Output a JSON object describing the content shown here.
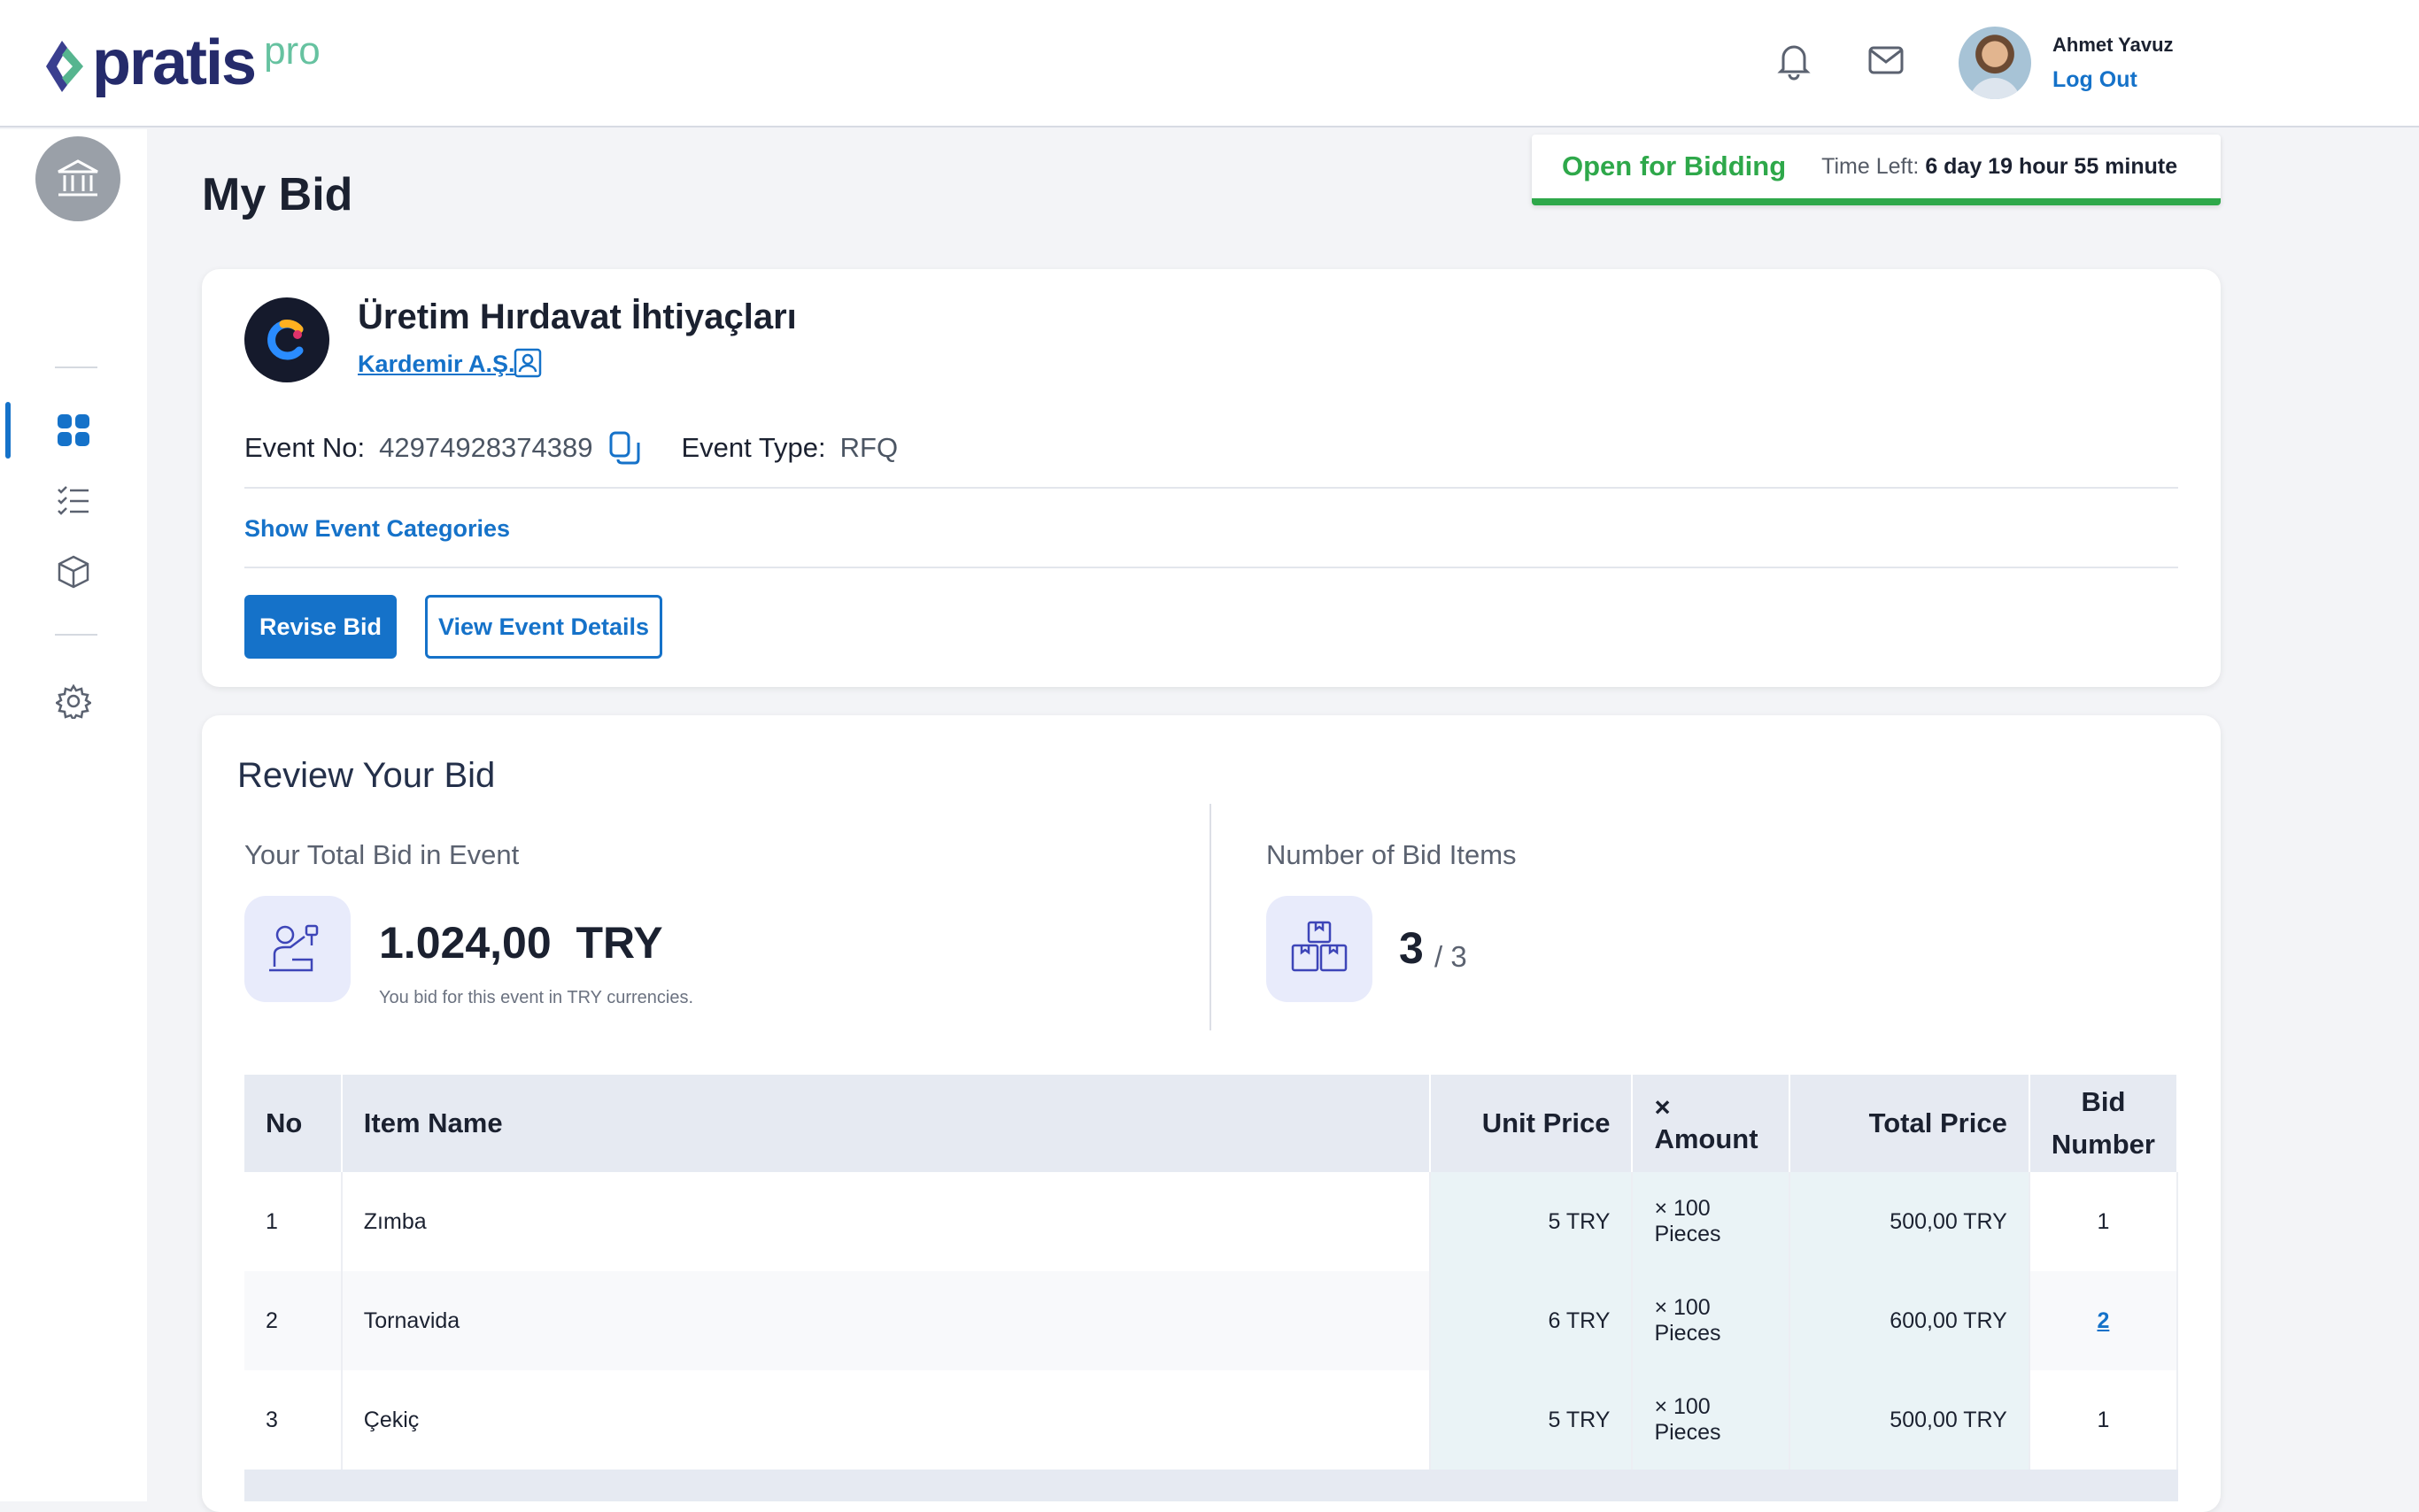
{
  "header": {
    "logo_text": "pratis",
    "logo_suffix": "pro",
    "user_name": "Ahmet Yavuz",
    "logout_label": "Log Out",
    "icons": [
      "bell-icon",
      "mail-icon"
    ]
  },
  "sidebar": {
    "items": [
      {
        "name": "dashboard",
        "icon": "grid-icon",
        "active": true
      },
      {
        "name": "tasks",
        "icon": "checklist-icon",
        "active": false
      },
      {
        "name": "products",
        "icon": "cube-icon",
        "active": false
      },
      {
        "name": "settings",
        "icon": "gear-icon",
        "active": false
      }
    ]
  },
  "page": {
    "title": "My Bid"
  },
  "status": {
    "label": "Open for Bidding",
    "time_left_label": "Time Left:",
    "time_left_value": "6 day 19 hour 55 minute",
    "color": "#2ea84a"
  },
  "event": {
    "title": "Üretim Hırdavat İhtiyaçları",
    "company": "Kardemir A.Ş.",
    "event_no_label": "Event No:",
    "event_no": "42974928374389",
    "event_type_label": "Event Type:",
    "event_type": "RFQ",
    "show_categories_label": "Show Event Categories",
    "revise_label": "Revise Bid",
    "view_details_label": "View Event Details"
  },
  "review": {
    "title": "Review Your Bid",
    "total_label": "Your Total Bid in Event",
    "total_value": "1.024,00",
    "total_currency": "TRY",
    "total_note": "You bid for this event in TRY currencies.",
    "items_label": "Number of Bid Items",
    "items_count": "3",
    "items_total": "/ 3"
  },
  "table": {
    "headers": {
      "no": "No",
      "item_name": "Item Name",
      "unit_price": "Unit Price",
      "amount": "× Amount",
      "total_price": "Total Price",
      "bid_number_line1": "Bid",
      "bid_number_line2": "Number"
    },
    "rows": [
      {
        "no": "1",
        "item": "Zımba",
        "unit_price": "5 TRY",
        "amount": "× 100 Pieces",
        "total": "500,00 TRY",
        "bid_number": "1",
        "bid_link": false
      },
      {
        "no": "2",
        "item": "Tornavida",
        "unit_price": "6 TRY",
        "amount": "× 100 Pieces",
        "total": "600,00 TRY",
        "bid_number": "2",
        "bid_link": true
      },
      {
        "no": "3",
        "item": "Çekiç",
        "unit_price": "5 TRY",
        "amount": "× 100 Pieces",
        "total": "500,00 TRY",
        "bid_number": "1",
        "bid_link": false
      }
    ]
  },
  "colors": {
    "primary": "#1572c9",
    "success": "#2ea84a",
    "brand_navy": "#252b6b",
    "brand_green": "#66c2a0"
  }
}
